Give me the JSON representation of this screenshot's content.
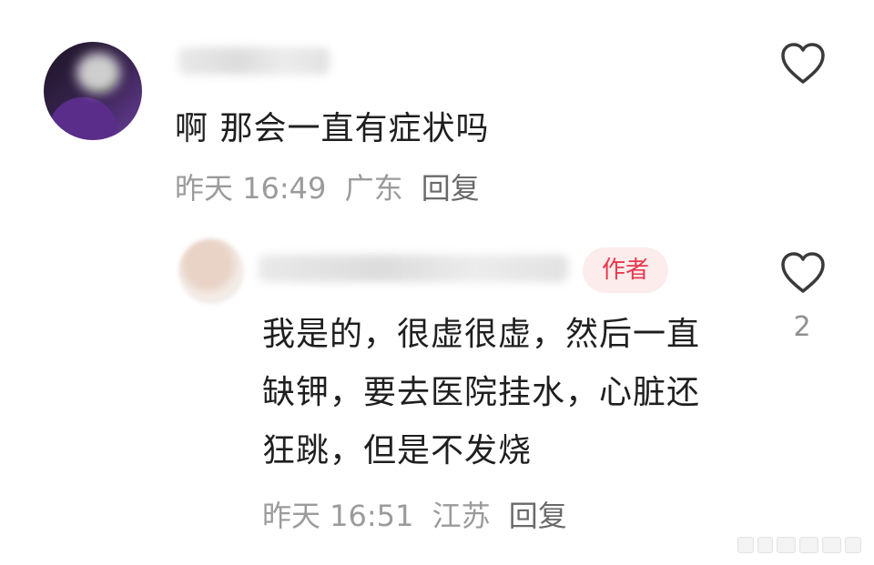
{
  "comment": {
    "text": "啊 那会一直有症状吗",
    "time": "昨天 16:49",
    "location": "广东",
    "reply_label": "回复"
  },
  "reply": {
    "author_badge": "作者",
    "text": "我是的，很虚很虚，然后一直缺钾，要去医院挂水，心脏还狂跳，但是不发烧",
    "time": "昨天 16:51",
    "location": "江苏",
    "reply_label": "回复",
    "like_count": "2"
  },
  "icons": {
    "like": "heart-outline-icon"
  },
  "colors": {
    "badge_text": "#e8384f",
    "badge_bg": "#fdecec",
    "meta_text": "#9b9b9b"
  }
}
